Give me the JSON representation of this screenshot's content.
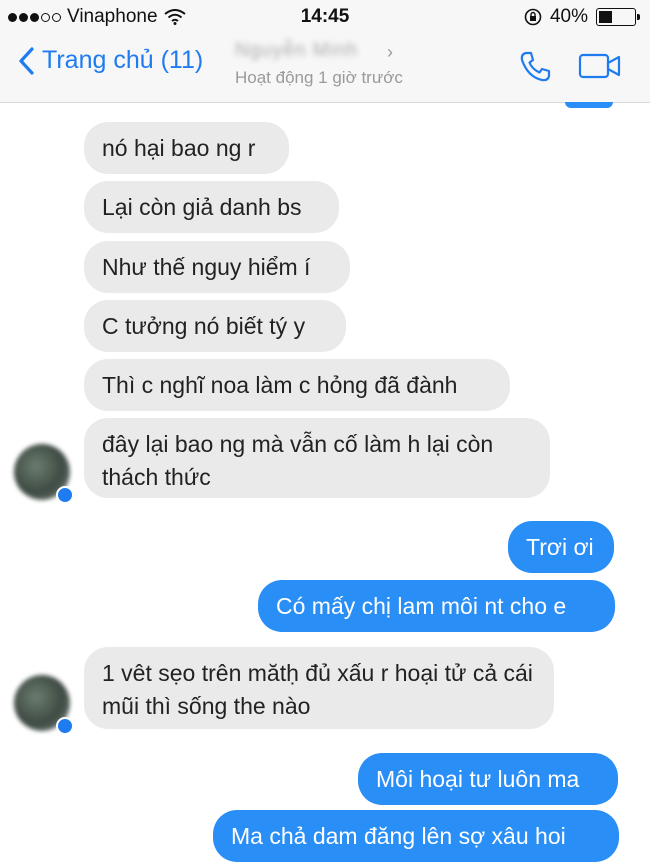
{
  "status_bar": {
    "carrier": "Vinaphone",
    "time": "14:45",
    "battery": "40%",
    "battery_level": 0.4
  },
  "nav": {
    "back_label": "Trang chủ (11)",
    "contact_name": "Nguyễn Minh",
    "contact_status": "Hoạt động 1 giờ trước"
  },
  "messages": [
    {
      "side": "in",
      "text": "nó hại bao ng r"
    },
    {
      "side": "in",
      "text": "Lại còn giả danh bs"
    },
    {
      "side": "in",
      "text": "Như thế nguy hiểm í"
    },
    {
      "side": "in",
      "text": "C tưởng nó biết tý y"
    },
    {
      "side": "in",
      "text": "Thì c nghĩ noa làm c hỏng đã đành"
    },
    {
      "side": "in",
      "text": "đây lại bao ng mà vẫn cố làm h lại còn thách thức"
    },
    {
      "side": "out",
      "text": "Trơi ơi"
    },
    {
      "side": "out",
      "text": "Có mấy chị lam môi nt cho e"
    },
    {
      "side": "in",
      "text": "1 vêt sẹo trên mătḥ đủ xấu r hoại tử cả cái mũi thì sống the nào"
    },
    {
      "side": "out",
      "text": "Môi hoại tư luôn ma"
    },
    {
      "side": "out",
      "text": "Ma chả dam đăng lên sợ xâu hoi"
    }
  ],
  "colors": {
    "accent": "#1f7cf0",
    "outgoing_bubble": "#2a8ef7",
    "incoming_bubble": "#eaeaea"
  },
  "icons": [
    "back-chevron-icon",
    "phone-icon",
    "video-camera-icon",
    "wifi-icon",
    "lock-rotation-icon",
    "battery-icon"
  ]
}
